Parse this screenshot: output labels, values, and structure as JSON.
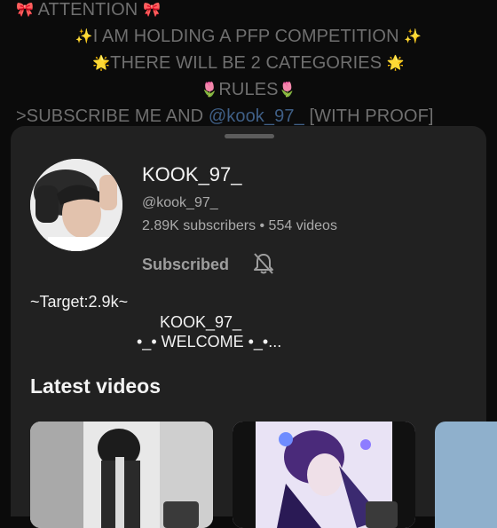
{
  "post": {
    "line1": "ATTENTION",
    "line2": "I AM HOLDING A PFP COMPETITION",
    "line3": "THERE WILL BE 2 CATEGORIES",
    "line4": "RULES",
    "line5_prefix": ">SUBSCRIBE ME AND ",
    "line5_mention": "@kook_97_",
    "line5_suffix": " [WITH PROOF]"
  },
  "channel": {
    "name": "KOOK_97_",
    "handle": "@kook_97_",
    "stats": "2.89K subscribers • 554 videos",
    "subscribe_label": "Subscribed",
    "description": [
      "~Target:2.9k~",
      "KOOK_97_",
      "•_• WELCOME •_•..."
    ]
  },
  "sections": {
    "latest_videos": "Latest videos"
  },
  "icons": [
    "bow-icon",
    "sparkles-icon",
    "star-icon",
    "tulip-icon",
    "bell-off-icon"
  ],
  "colors": {
    "sheet": "#212121",
    "background": "#0b0b0b",
    "mention": "#3f5f86"
  }
}
